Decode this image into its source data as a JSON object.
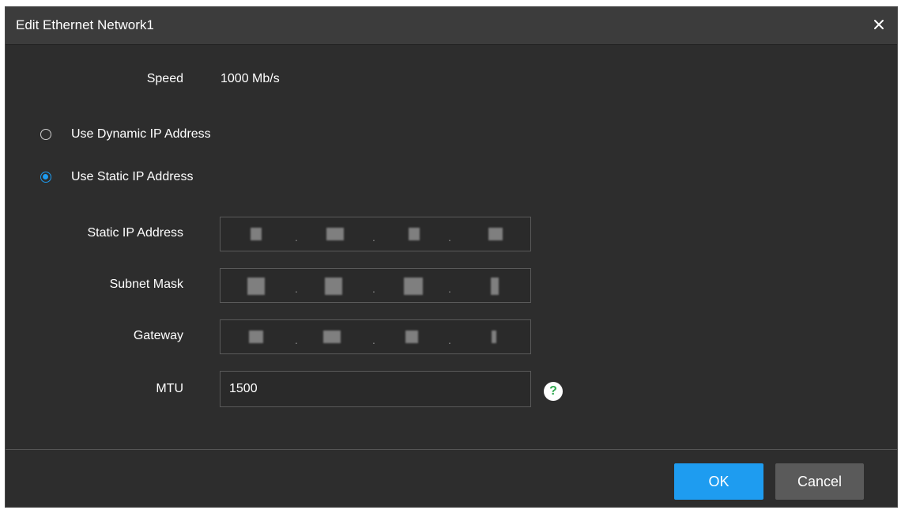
{
  "dialog": {
    "title": "Edit Ethernet Network1",
    "close_icon": "close-icon"
  },
  "speed": {
    "label": "Speed",
    "value": "1000 Mb/s"
  },
  "ip_mode": {
    "options": [
      {
        "label": "Use Dynamic IP Address",
        "selected": false
      },
      {
        "label": "Use Static IP Address",
        "selected": true
      }
    ]
  },
  "fields": {
    "static_ip": {
      "label": "Static IP Address"
    },
    "subnet_mask": {
      "label": "Subnet Mask"
    },
    "gateway": {
      "label": "Gateway"
    },
    "mtu": {
      "label": "MTU",
      "value": "1500"
    }
  },
  "help_icon": {
    "icon": "help-icon",
    "glyph": "?"
  },
  "buttons": {
    "ok_label": "OK",
    "cancel_label": "Cancel"
  },
  "colors": {
    "accent": "#1e9cf0",
    "background": "#2d2d2d",
    "titlebar": "#3c3c3c",
    "help_icon": "#2fa84f"
  }
}
